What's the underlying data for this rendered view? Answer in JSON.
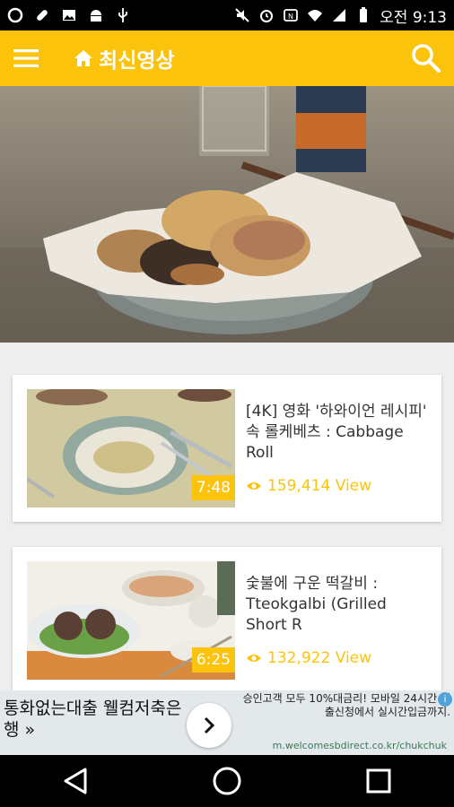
{
  "status_bar": {
    "time": "오전 9:13",
    "left_icons": [
      "opera-icon",
      "bandage-icon",
      "image-icon",
      "android-icon",
      "usb-icon"
    ],
    "right_icons": [
      "mute-icon",
      "alarm-icon",
      "nfc-icon",
      "wifi-icon",
      "signal-icon",
      "battery-icon"
    ]
  },
  "app_bar": {
    "title": "최신영상",
    "menu_icon": "hamburger-menu-icon",
    "home_icon": "home-icon",
    "search_icon": "search-icon",
    "accent_color": "#fcc30c"
  },
  "videos": [
    {
      "title": "[4K] 영화 '하와이언 레시피' 속 롤케베츠 : Cabbage Roll",
      "duration": "7:48",
      "views": "159,414 View"
    },
    {
      "title": "숯불에 구운 떡갈비 : Tteokgalbi (Grilled Short R",
      "duration": "6:25",
      "views": "132,922 View"
    }
  ],
  "ad": {
    "title": "통화없는대출 웰컴저축은행 »",
    "text": "승인고객 모두 10%대금리! 모바일 24시간 대출신청에서 실시간입금까지.",
    "url": "m.welcomesbdirect.co.kr/chukchuk",
    "info_icon": "i"
  },
  "nav": {
    "icons": [
      "back-icon",
      "home-circle-icon",
      "recents-icon"
    ]
  }
}
